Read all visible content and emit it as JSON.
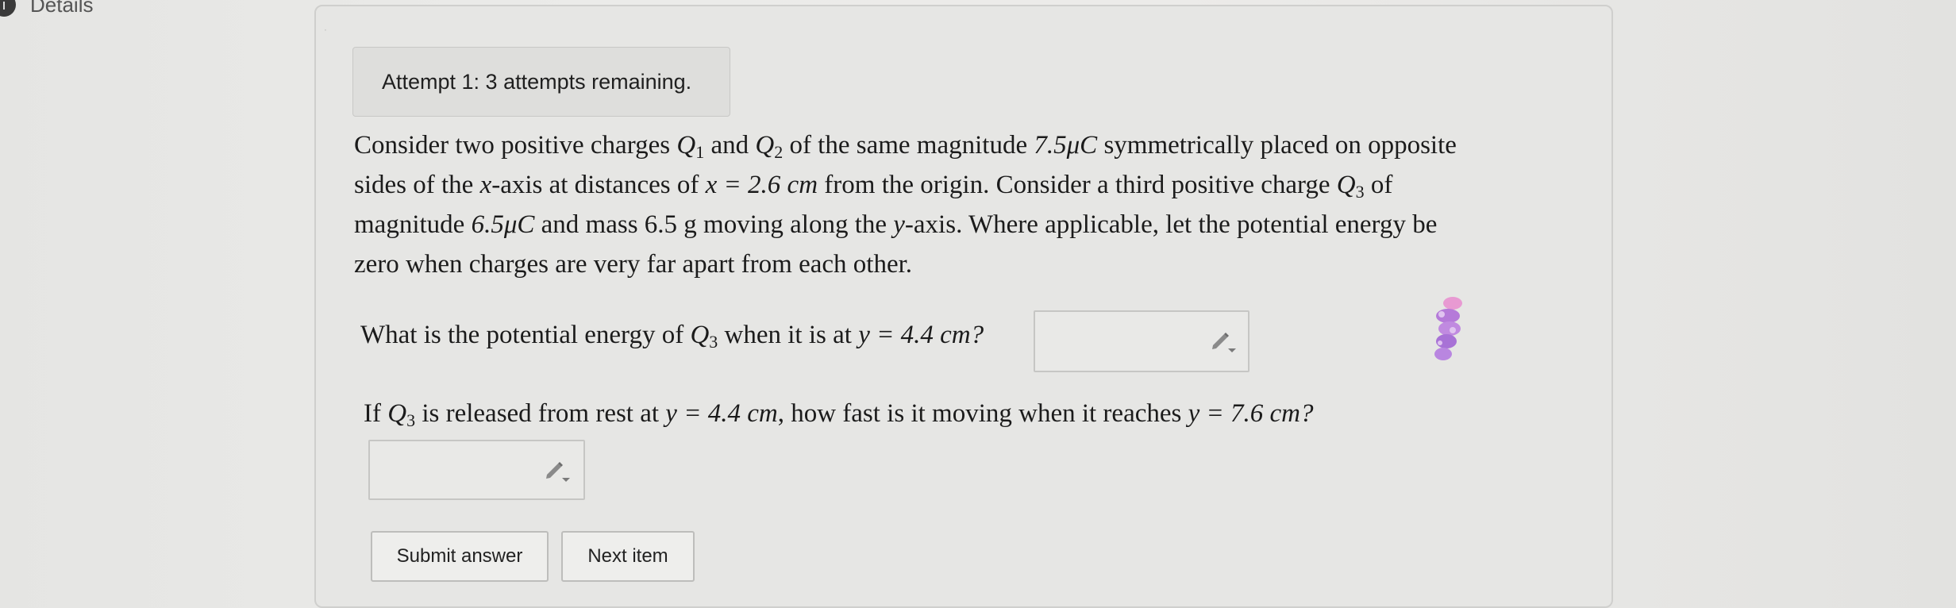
{
  "header": {
    "details_label": "Details",
    "info_icon": "i"
  },
  "attempt": {
    "text": "Attempt 1: 3 attempts remaining."
  },
  "problem": {
    "line1": {
      "t1": "Consider two positive charges ",
      "Q1": "Q",
      "Q1sub": "1",
      "t2": " and ",
      "Q2": "Q",
      "Q2sub": "2",
      "t3": " of the same magnitude ",
      "mag": "7.5μC",
      "t4": " symmetrically placed on opposite"
    },
    "line2": {
      "t1": "sides of the ",
      "x": "x",
      "t2": "-axis at distances of ",
      "eq": "x = 2.6 cm",
      "t3": " from the origin. Consider a third positive charge ",
      "Q3": "Q",
      "Q3sub": "3",
      "t4": " of"
    },
    "line3": {
      "t1": "magnitude ",
      "mag": "6.5μC",
      "t2": " and mass 6.5 g moving along the ",
      "y": "y",
      "t3": "-axis. Where applicable, let the potential energy be"
    },
    "line4": "zero when charges are very far apart from each other."
  },
  "question1": {
    "t1": "What is the potential energy of ",
    "Q": "Q",
    "Qsub": "3",
    "t2": " when it is at ",
    "eq": "y = 4.4 cm?"
  },
  "question2": {
    "t1": "If ",
    "Q": "Q",
    "Qsub": "3",
    "t2": " is released from rest at ",
    "eq1": "y = 4.4 cm",
    "t3": ", how fast is it moving when it reaches ",
    "eq2": "y = 7.6 cm?"
  },
  "answers": {
    "answer1_value": "",
    "answer2_value": "",
    "edit_icon": "pencil-dropdown-icon"
  },
  "buttons": {
    "submit_label": "Submit answer",
    "next_label": "Next item"
  },
  "colors": {
    "background": "#e9e9e7",
    "card_border": "#cfcfcd",
    "sticker_primary": "#b57ad9",
    "sticker_secondary": "#e89ad2"
  }
}
